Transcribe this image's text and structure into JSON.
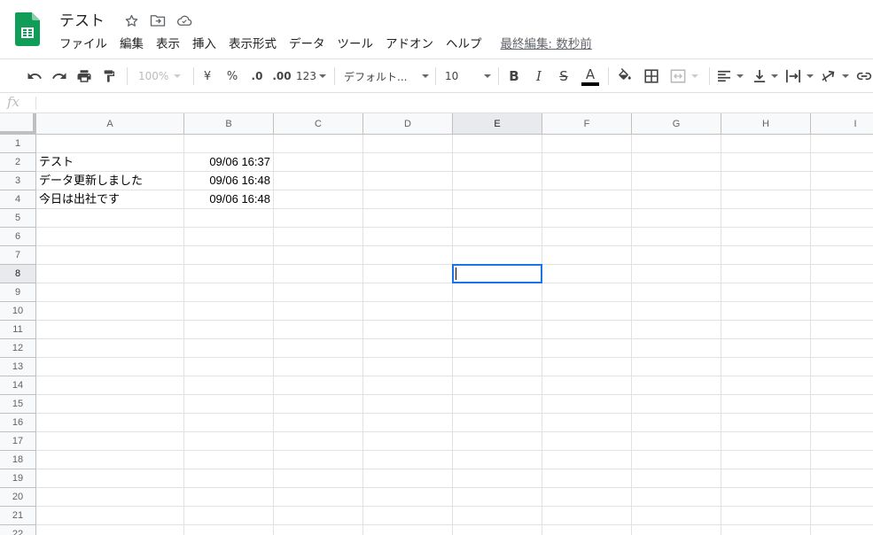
{
  "doc": {
    "title": "テスト",
    "last_edit": "最終編集: 数秒前"
  },
  "menu": [
    "ファイル",
    "編集",
    "表示",
    "挿入",
    "表示形式",
    "データ",
    "ツール",
    "アドオン",
    "ヘルプ"
  ],
  "toolbar": {
    "zoom": "100%",
    "currency": "¥",
    "percent": "%",
    "decimal_decrease": ".0",
    "decimal_increase": ".00",
    "more_formats": "123",
    "font": "デフォルト...",
    "font_size": "10",
    "bold": "B",
    "italic": "I",
    "strikethrough": "S",
    "text_color": "A"
  },
  "formula_bar": {
    "label": "fx",
    "value": ""
  },
  "sheet": {
    "columns": [
      "A",
      "B",
      "C",
      "D",
      "E",
      "F",
      "G",
      "H",
      "I"
    ],
    "active_column": "E",
    "active_row": 8,
    "rows": [
      {
        "n": "1",
        "a": "",
        "b": ""
      },
      {
        "n": "2",
        "a": "テスト",
        "b": "09/06 16:37"
      },
      {
        "n": "3",
        "a": "データ更新しました",
        "b": "09/06 16:48"
      },
      {
        "n": "4",
        "a": "今日は出社です",
        "b": "09/06 16:48"
      },
      {
        "n": "5",
        "a": "",
        "b": ""
      },
      {
        "n": "6",
        "a": "",
        "b": ""
      },
      {
        "n": "7",
        "a": "",
        "b": ""
      },
      {
        "n": "8",
        "a": "",
        "b": ""
      },
      {
        "n": "9",
        "a": "",
        "b": ""
      },
      {
        "n": "10",
        "a": "",
        "b": ""
      },
      {
        "n": "11",
        "a": "",
        "b": ""
      },
      {
        "n": "12",
        "a": "",
        "b": ""
      },
      {
        "n": "13",
        "a": "",
        "b": ""
      },
      {
        "n": "14",
        "a": "",
        "b": ""
      },
      {
        "n": "15",
        "a": "",
        "b": ""
      },
      {
        "n": "16",
        "a": "",
        "b": ""
      },
      {
        "n": "17",
        "a": "",
        "b": ""
      },
      {
        "n": "18",
        "a": "",
        "b": ""
      },
      {
        "n": "19",
        "a": "",
        "b": ""
      },
      {
        "n": "20",
        "a": "",
        "b": ""
      },
      {
        "n": "21",
        "a": "",
        "b": ""
      },
      {
        "n": "22",
        "a": "",
        "b": ""
      }
    ]
  },
  "colors": {
    "sheets_green": "#0f9d58",
    "selection_blue": "#1a73e8",
    "header_bg": "#f8f9fa",
    "active_header_bg": "#e8eaed",
    "gridline": "#e2e2e2"
  }
}
